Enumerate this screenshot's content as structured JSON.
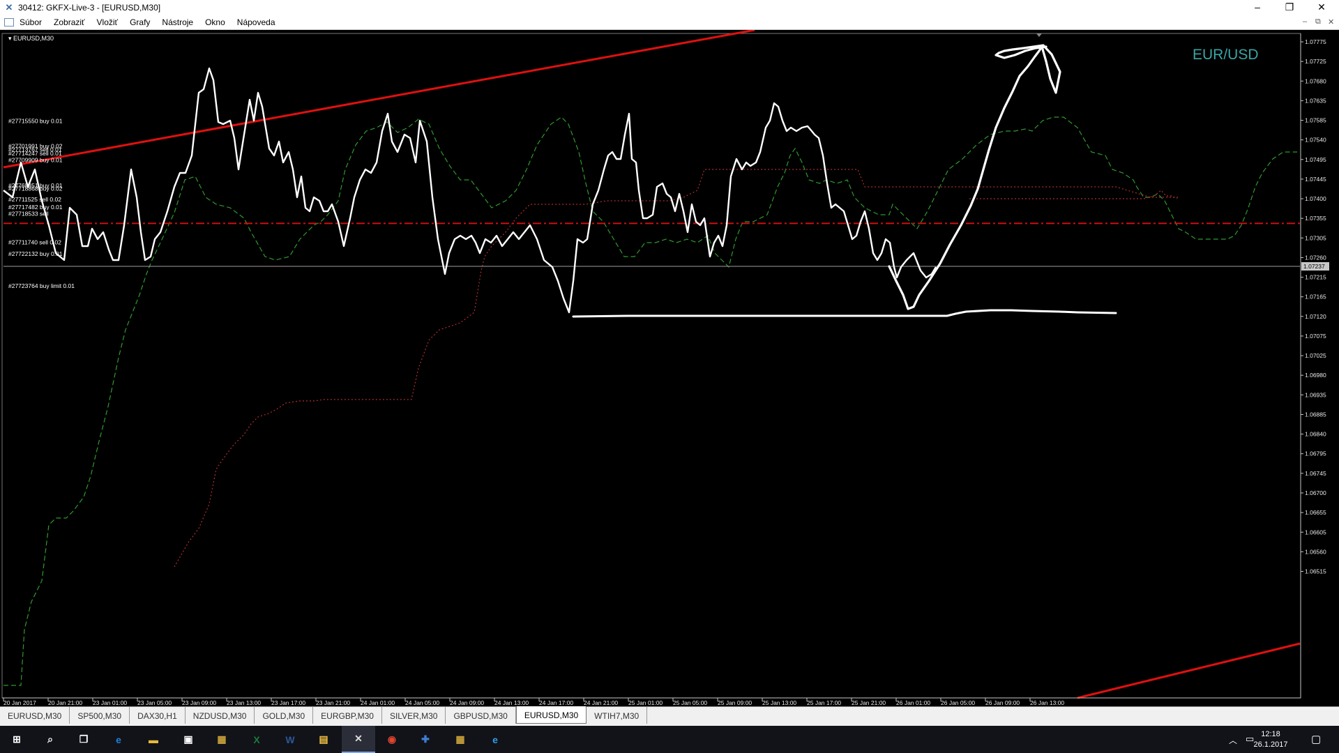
{
  "window": {
    "title": "30412: GKFX-Live-3 - [EURUSD,M30]",
    "buttons": {
      "minimize": "–",
      "restore": "❐",
      "close": "✕"
    }
  },
  "menu": [
    "Súbor",
    "Zobraziť",
    "Vložiť",
    "Grafy",
    "Nástroje",
    "Okno",
    "Nápoveda"
  ],
  "chart": {
    "symbol_label": "▾ EURUSD,M30",
    "watermark": "EUR/USD",
    "current_price": "1.07237",
    "colors": {
      "bg": "#000000",
      "price": "#ffffff",
      "trend": "#e01010",
      "order_line": "#d01010",
      "span_green": "#2f9a2f",
      "span_red": "#b02e2e",
      "watermark": "#3aa5a5"
    },
    "price_ticks": [
      "1.07775",
      "1.07725",
      "1.07680",
      "1.07635",
      "1.07585",
      "1.07540",
      "1.07495",
      "1.07445",
      "1.07400",
      "1.07355",
      "1.07305",
      "1.07260",
      "1.07215",
      "1.07165",
      "1.07120",
      "1.07075",
      "1.07025",
      "1.06980",
      "1.06935",
      "1.06885",
      "1.06840",
      "1.06795",
      "1.06745",
      "1.06700",
      "1.06655",
      "1.06605",
      "1.06560",
      "1.06515"
    ],
    "time_ticks": [
      "20 Jan 2017",
      "20 Jan 21:00",
      "23 Jan 01:00",
      "23 Jan 05:00",
      "23 Jan 09:00",
      "23 Jan 13:00",
      "23 Jan 17:00",
      "23 Jan 21:00",
      "24 Jan 01:00",
      "24 Jan 05:00",
      "24 Jan 09:00",
      "24 Jan 13:00",
      "24 Jan 17:00",
      "24 Jan 21:00",
      "25 Jan 01:00",
      "25 Jan 05:00",
      "25 Jan 09:00",
      "25 Jan 13:00",
      "25 Jan 17:00",
      "25 Jan 21:00",
      "26 Jan 01:00",
      "26 Jan 05:00",
      "26 Jan 09:00",
      "26 Jan 13:00"
    ],
    "order_labels": [
      {
        "text": "#27715550 buy 0.01",
        "price": 1.0758
      },
      {
        "text": "#27701991 buy 0.02",
        "price": 1.0752
      },
      {
        "text": "#27713767 sell 0.01",
        "price": 1.07512
      },
      {
        "text": "#27714247 sell 0.01",
        "price": 1.07503
      },
      {
        "text": "#27709909 buy 0.01",
        "price": 1.07487
      },
      {
        "text": "#27768851 buy 0.01",
        "price": 1.07426
      },
      {
        "text": "#27718868 buy 0.02",
        "price": 1.07418
      },
      {
        "text": "#27711525 sell 0.02",
        "price": 1.07392
      },
      {
        "text": "#27717482 buy 0.01",
        "price": 1.07374
      },
      {
        "text": "#27718533 sell",
        "price": 1.07358
      },
      {
        "text": "#27711740 sell 0.02",
        "price": 1.0729
      },
      {
        "text": "#27722132 buy 0.01",
        "price": 1.07262
      },
      {
        "text": "#27723764 buy limit 0.01",
        "price": 1.07185
      }
    ]
  },
  "tabs": [
    {
      "label": "EURUSD,M30",
      "active": false
    },
    {
      "label": "SP500,M30",
      "active": false
    },
    {
      "label": "DAX30,H1",
      "active": false
    },
    {
      "label": "NZDUSD,M30",
      "active": false
    },
    {
      "label": "GOLD,M30",
      "active": false
    },
    {
      "label": "EURGBP,M30",
      "active": false
    },
    {
      "label": "SILVER,M30",
      "active": false
    },
    {
      "label": "GBPUSD,M30",
      "active": false
    },
    {
      "label": "EURUSD,M30",
      "active": true
    },
    {
      "label": "WTIH7,M30",
      "active": false
    }
  ],
  "taskbar": {
    "icons": [
      {
        "name": "start-icon",
        "glyph": "⊞",
        "color": "#ffffff"
      },
      {
        "name": "search-icon",
        "glyph": "⌕",
        "color": "#ffffff"
      },
      {
        "name": "task-view-icon",
        "glyph": "❐",
        "color": "#ffffff"
      },
      {
        "name": "edge-icon",
        "glyph": "e",
        "color": "#1e7fd8"
      },
      {
        "name": "file-explorer-icon",
        "glyph": "▬",
        "color": "#e8b93c"
      },
      {
        "name": "store-icon",
        "glyph": "▣",
        "color": "#ffffff"
      },
      {
        "name": "app-icon",
        "glyph": "▦",
        "color": "#c9a23a"
      },
      {
        "name": "excel-icon",
        "glyph": "X",
        "color": "#1d7a3d"
      },
      {
        "name": "word-icon",
        "glyph": "W",
        "color": "#2b5797"
      },
      {
        "name": "folder-icon",
        "glyph": "▤",
        "color": "#f0c040"
      },
      {
        "name": "metatrader-icon",
        "glyph": "✕",
        "color": "#dddddd"
      },
      {
        "name": "chrome-icon",
        "glyph": "◉",
        "color": "#e0452f"
      },
      {
        "name": "network-app-icon",
        "glyph": "✚",
        "color": "#3d7fd6"
      },
      {
        "name": "app2-icon",
        "glyph": "▦",
        "color": "#c9a23a"
      },
      {
        "name": "ie-icon",
        "glyph": "e",
        "color": "#2f9ee8"
      }
    ],
    "time": "12:18",
    "date": "26.1.2017"
  }
}
